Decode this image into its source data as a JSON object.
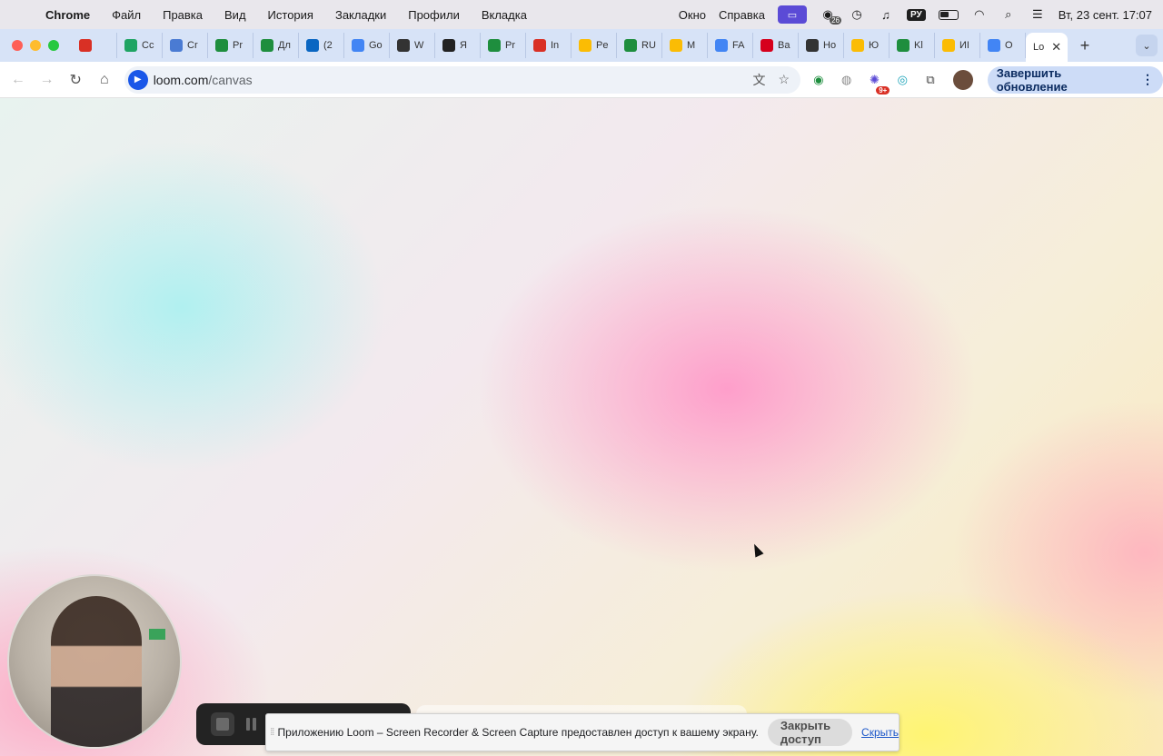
{
  "menubar": {
    "app_name": "Chrome",
    "items": [
      "Файл",
      "Правка",
      "Вид",
      "История",
      "Закладки",
      "Профили",
      "Вкладка"
    ],
    "right_items": [
      "Окно",
      "Справка"
    ],
    "tray": {
      "keyboard_layout": "РУ",
      "notification_count": "26",
      "datetime": "Вт, 23 сент.  17:07"
    }
  },
  "tabs": [
    {
      "label": "",
      "icon": "record-icon",
      "color": "#d93025"
    },
    {
      "label": "Cc",
      "icon": "drive-icon",
      "color": "#1fa463"
    },
    {
      "label": "Cr",
      "icon": "cap-icon",
      "color": "#4a7bd3"
    },
    {
      "label": "Pr",
      "icon": "sheets-icon",
      "color": "#1e8e3e"
    },
    {
      "label": "Дл",
      "icon": "sheets-icon",
      "color": "#1e8e3e"
    },
    {
      "label": "(2",
      "icon": "linkedin-icon",
      "color": "#0a66c2"
    },
    {
      "label": "Go",
      "icon": "translate-icon",
      "color": "#4285f4"
    },
    {
      "label": "W",
      "icon": "timer-icon",
      "color": "#333333"
    },
    {
      "label": "Я",
      "icon": "ya-icon",
      "color": "#222222"
    },
    {
      "label": "Pr",
      "icon": "sheets-icon",
      "color": "#1e8e3e"
    },
    {
      "label": "In",
      "icon": "gmail-icon",
      "color": "#d93025"
    },
    {
      "label": "Pe",
      "icon": "drive-icon",
      "color": "#fbbc04"
    },
    {
      "label": "RU",
      "icon": "sheets-icon",
      "color": "#1e8e3e"
    },
    {
      "label": "M",
      "icon": "drive-icon",
      "color": "#fbbc04"
    },
    {
      "label": "FA",
      "icon": "docs-icon",
      "color": "#4285f4"
    },
    {
      "label": "Ba",
      "icon": "hh-icon",
      "color": "#d6001c"
    },
    {
      "label": "Ho",
      "icon": "github-icon",
      "color": "#333333"
    },
    {
      "label": "Ю",
      "icon": "drive-icon",
      "color": "#fbbc04"
    },
    {
      "label": "Kl",
      "icon": "sheets-icon",
      "color": "#1e8e3e"
    },
    {
      "label": "ИI",
      "icon": "drive-icon",
      "color": "#fbbc04"
    },
    {
      "label": "O",
      "icon": "docs-icon",
      "color": "#4285f4"
    }
  ],
  "active_tab": {
    "label": "Lo",
    "close": "✕"
  },
  "new_tab": "+",
  "toolbar": {
    "url_host": "loom.com",
    "url_path": "/canvas",
    "ext_badge": "9+",
    "update_label": "Завершить обновление"
  },
  "share_bar": {
    "message": "Приложению Loom – Screen Recorder & Screen Capture предоставлен доступ к вашему экрану.",
    "stop_label": "Закрыть доступ",
    "hide_label": "Скрыть"
  },
  "colors": {
    "tab_strip": "#d7e3f7",
    "update_button": "#cddcf7",
    "loom_blue": "#1a57e8"
  }
}
